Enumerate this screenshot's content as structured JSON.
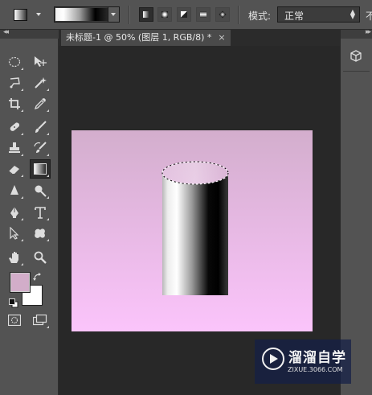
{
  "options_bar": {
    "mode_label": "模式:",
    "mode_value": "正常",
    "trailing_char": "不",
    "gradient_types": [
      "linear-gradient",
      "radial-gradient",
      "angle-gradient",
      "reflected-gradient",
      "diamond-gradient"
    ],
    "active_gradient_type": "linear-gradient"
  },
  "document": {
    "tab_title": "未标题-1 @ 50% (图层 1, RGB/8) *",
    "tab_close": "×"
  },
  "tools": [
    "marquee",
    "move",
    "lasso",
    "magic-wand",
    "crop",
    "eyedropper",
    "healing-brush",
    "brush",
    "clone-stamp",
    "history-brush",
    "eraser",
    "gradient",
    "blur",
    "dodge",
    "pen",
    "type",
    "path-selection",
    "custom-shape",
    "hand",
    "zoom"
  ],
  "colors": {
    "foreground": "#d2adc9",
    "background": "#ffffff",
    "canvas_top": "#d3aecd",
    "canvas_bottom": "#fbc4fb"
  },
  "watermark": {
    "brand": "溜溜自学",
    "url": "ZIXUE.3066.COM"
  }
}
